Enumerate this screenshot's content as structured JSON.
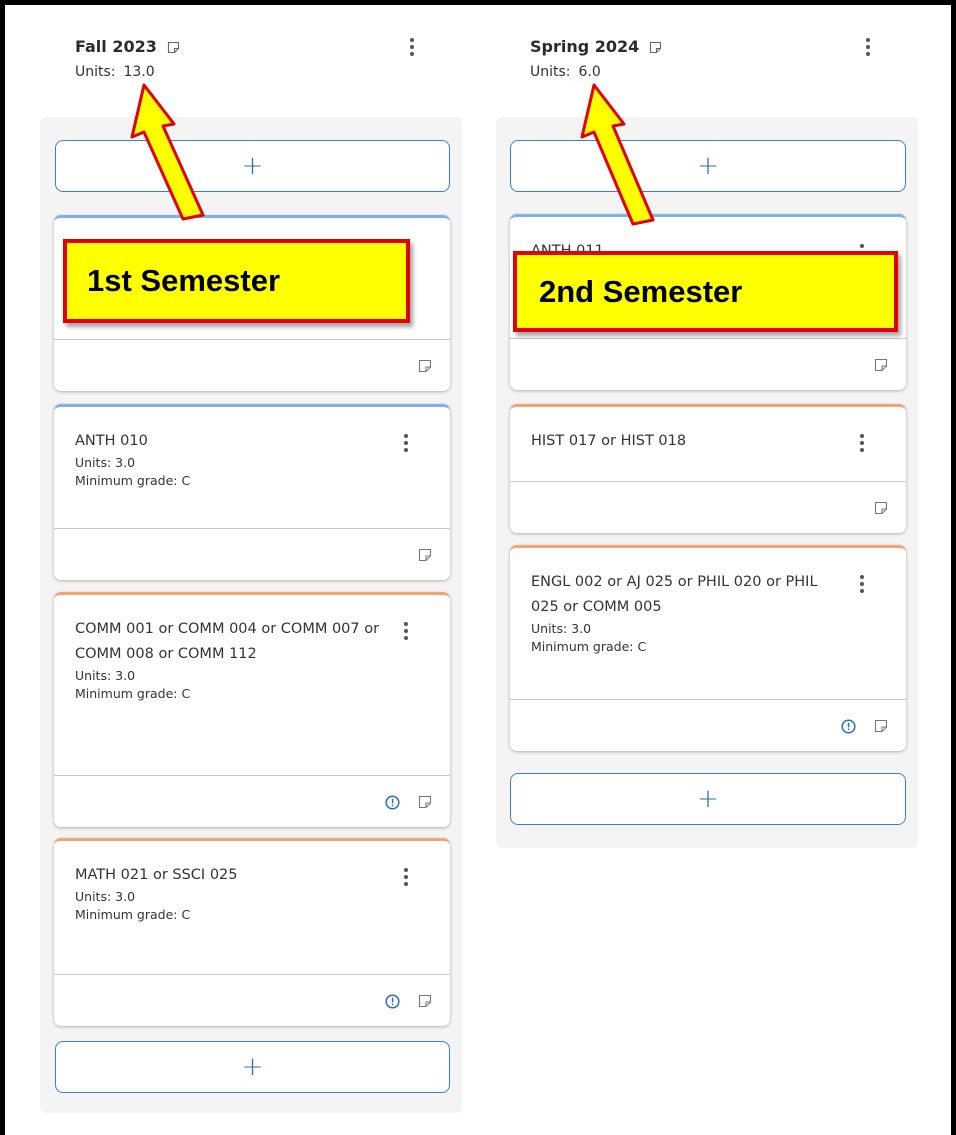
{
  "terms": [
    {
      "title": "Fall 2023",
      "units_label": "Units:",
      "units_value": "13.0",
      "callout": "1st Semester",
      "courses": [
        {
          "title": "ANTH 010",
          "units": "Units: 3.0",
          "grade": "Minimum grade: C"
        },
        {
          "title": "COMM 001 or COMM 004 or COMM 007 or COMM 008 or COMM 112",
          "units": "Units: 3.0",
          "grade": "Minimum grade: C"
        },
        {
          "title": "MATH 021 or SSCI 025",
          "units": "Units: 3.0",
          "grade": "Minimum grade: C"
        }
      ],
      "add_label": "+"
    },
    {
      "title": "Spring 2024",
      "units_label": "Units:",
      "units_value": "6.0",
      "callout": "2nd Semester",
      "courses": [
        {
          "title": "ANTH 011"
        },
        {
          "title": "HIST 017 or HIST 018"
        },
        {
          "title": "ENGL 002 or AJ 025 or PHIL 020 or PHIL 025 or COMM 005",
          "units": "Units: 3.0",
          "grade": "Minimum grade: C"
        }
      ],
      "add_label": "+"
    }
  ],
  "colors": {
    "accent_blue": "#3d7fc6",
    "card_border_blue": "#7fb0e8",
    "card_border_orange": "#f0a577",
    "callout_fill": "#ffff00",
    "callout_border": "#e00000",
    "arrow_fill": "#ffff00",
    "arrow_stroke": "#e00000"
  },
  "icons": [
    "note-icon",
    "more-vertical-icon",
    "warning-circle-icon",
    "plus-icon",
    "arrow-up-icon"
  ]
}
